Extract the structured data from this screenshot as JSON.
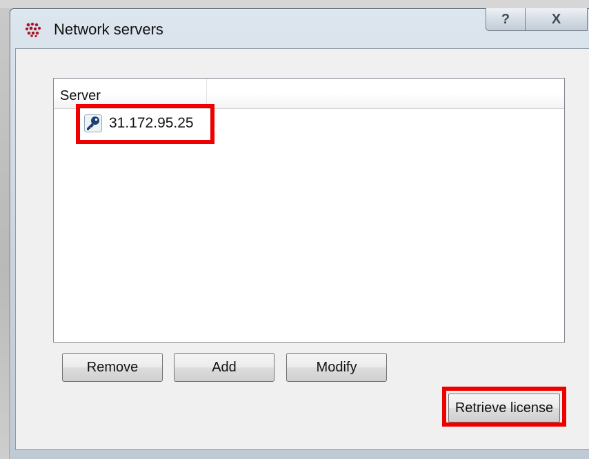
{
  "window": {
    "title": "Network servers",
    "help_label": "?",
    "close_label": "X"
  },
  "list": {
    "columns": [
      "Server"
    ],
    "rows": [
      {
        "label": "31.172.95.25",
        "icon": "key-icon"
      }
    ]
  },
  "buttons": {
    "remove": "Remove",
    "add": "Add",
    "modify": "Modify",
    "retrieve_license": "Retrieve license"
  },
  "colors": {
    "highlight": "#ee0000"
  }
}
